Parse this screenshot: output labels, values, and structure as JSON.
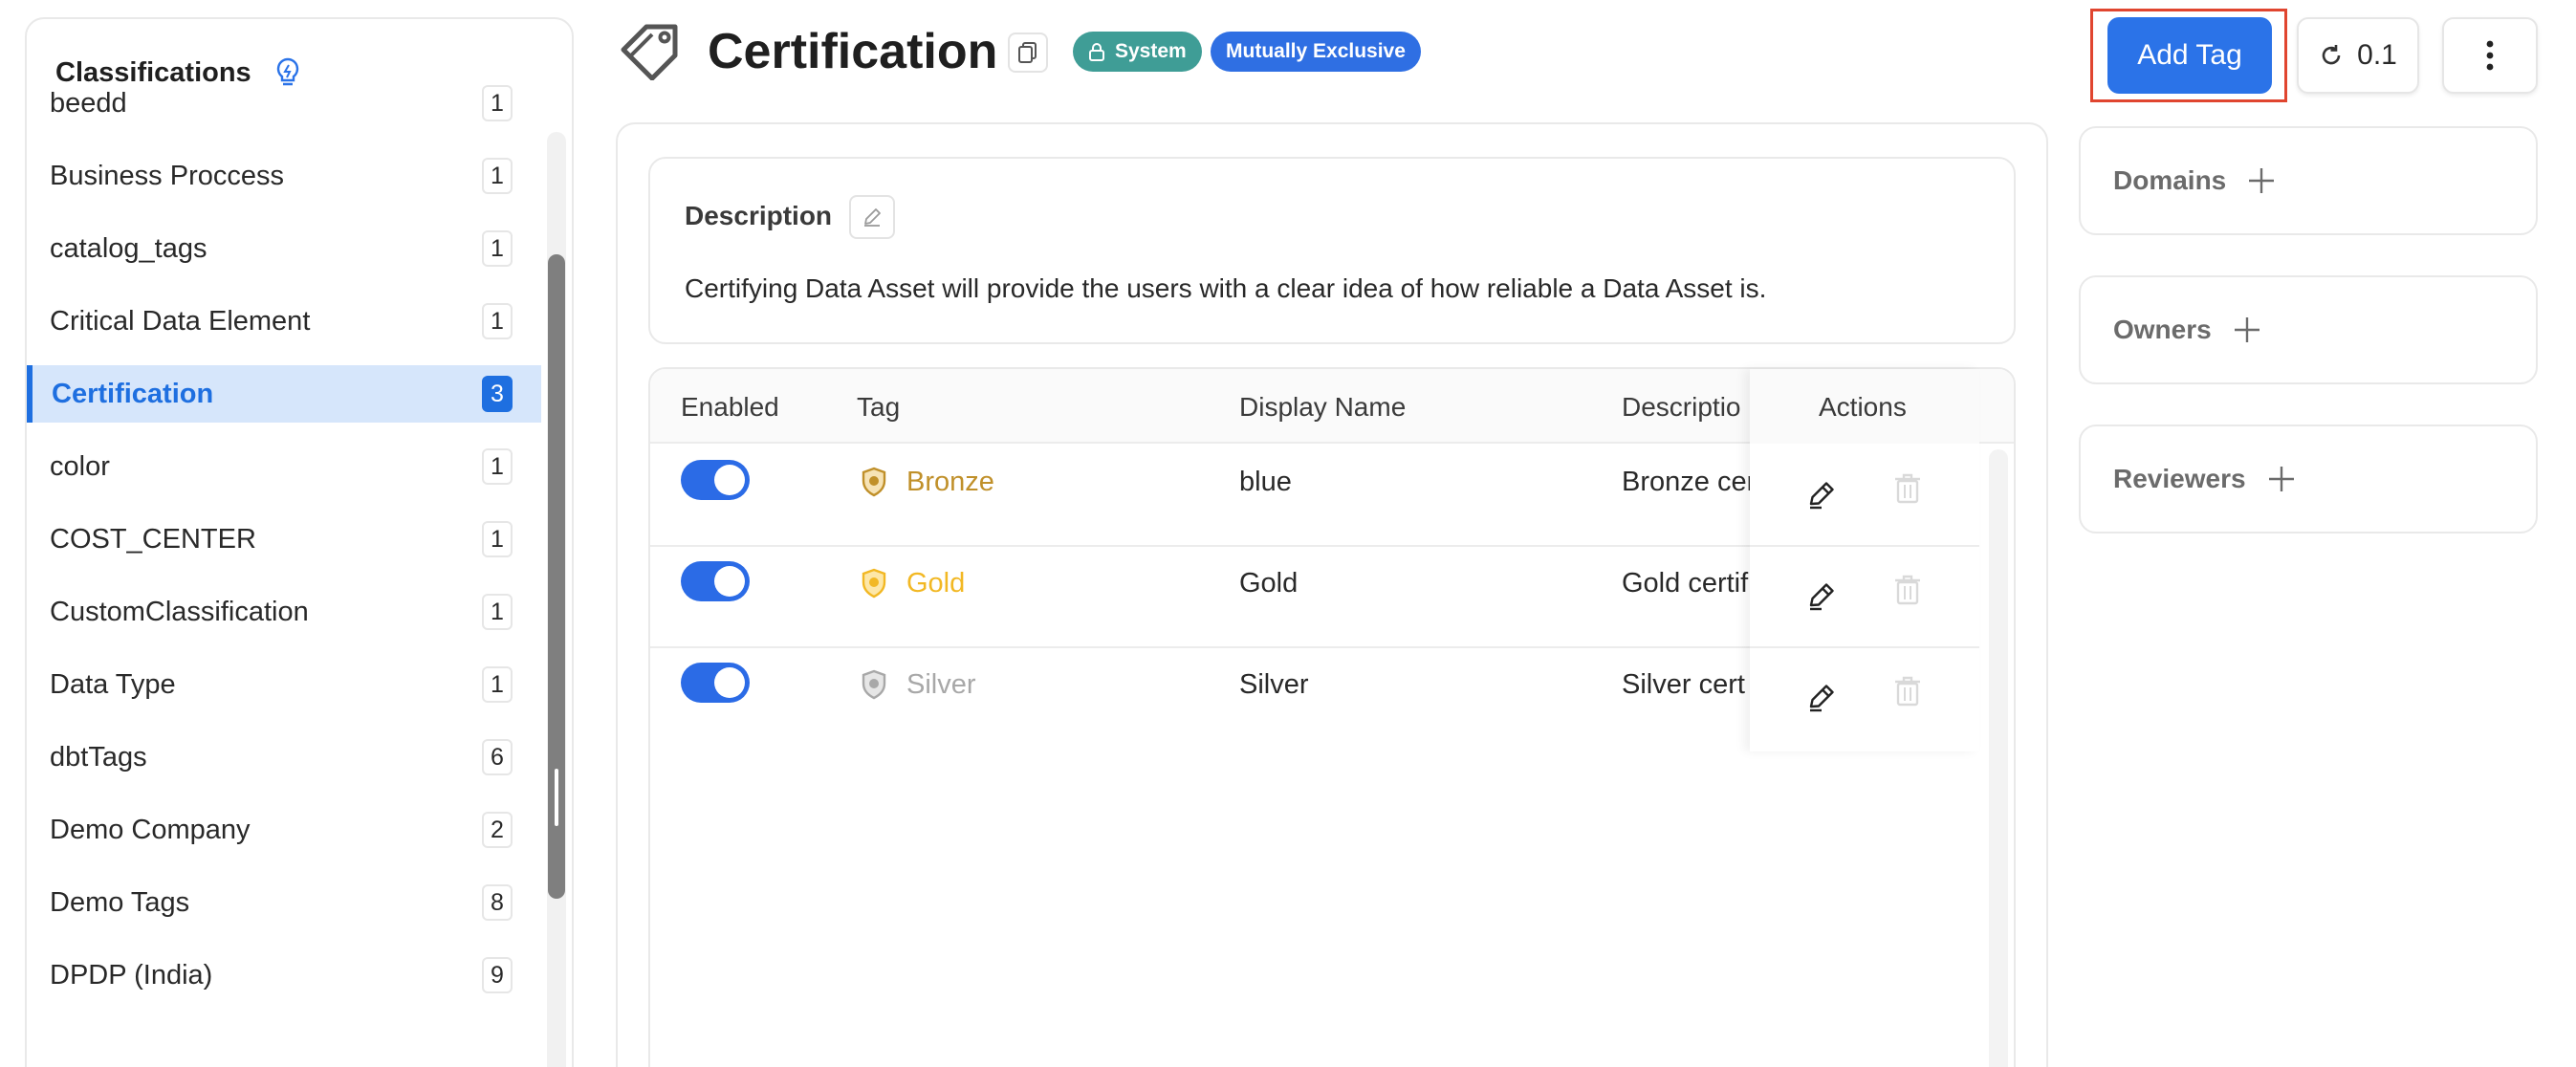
{
  "sidebar": {
    "title": "Classifications",
    "items": [
      {
        "label": "beedd",
        "count": "1"
      },
      {
        "label": "Business Proccess",
        "count": "1"
      },
      {
        "label": "catalog_tags",
        "count": "1"
      },
      {
        "label": "Critical Data Element",
        "count": "1"
      },
      {
        "label": "Certification",
        "count": "3"
      },
      {
        "label": "color",
        "count": "1"
      },
      {
        "label": "COST_CENTER",
        "count": "1"
      },
      {
        "label": "CustomClassification",
        "count": "1"
      },
      {
        "label": "Data Type",
        "count": "1"
      },
      {
        "label": "dbtTags",
        "count": "6"
      },
      {
        "label": "Demo Company",
        "count": "2"
      },
      {
        "label": "Demo Tags",
        "count": "8"
      },
      {
        "label": "DPDP (India)",
        "count": "9"
      }
    ],
    "selected": "Certification"
  },
  "header": {
    "title": "Certification",
    "badges": {
      "system": "System",
      "exclusive": "Mutually Exclusive"
    },
    "add_tag_label": "Add Tag",
    "version": "0.1"
  },
  "description": {
    "label": "Description",
    "text": "Certifying Data Asset will provide the users with a clear idea of how reliable a Data Asset is."
  },
  "table": {
    "headers": {
      "enabled": "Enabled",
      "tag": "Tag",
      "display_name": "Display Name",
      "description": "Descriptio",
      "actions": "Actions"
    },
    "rows": [
      {
        "tag": "Bronze",
        "display_name": "blue",
        "description": "Bronze cer",
        "enabled": true,
        "color": "#c0902a"
      },
      {
        "tag": "Gold",
        "display_name": "Gold",
        "description": "Gold certif",
        "enabled": true,
        "color": "#f2b824"
      },
      {
        "tag": "Silver",
        "display_name": "Silver",
        "description": "Silver cert",
        "enabled": true,
        "color": "#a8a8a8"
      }
    ]
  },
  "panels": {
    "domains": "Domains",
    "owners": "Owners",
    "reviewers": "Reviewers"
  },
  "colors": {
    "primary": "#2b73e8",
    "system_badge": "#3f9d96",
    "highlight_outline": "#e0452f"
  }
}
